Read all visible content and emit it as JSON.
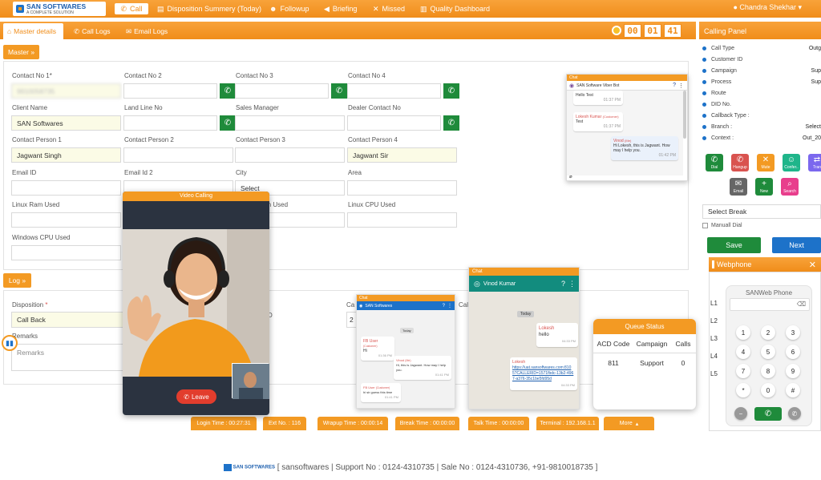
{
  "brand": {
    "name": "SAN SOFTWARES",
    "tagline": "A COMPLETE SOLUTION"
  },
  "nav": {
    "call": "Call",
    "disposition": "Disposition Summery (Today)",
    "followup": "Followup",
    "briefing": "Briefing",
    "missed": "Missed",
    "quality": "Quality Dashboard",
    "user": "Chandra Shekhar"
  },
  "tabs": {
    "master": "Master details",
    "call_logs": "Call Logs",
    "email_logs": "Email Logs"
  },
  "timer": [
    "00",
    "01",
    "41"
  ],
  "master": {
    "button": "Master",
    "fields": [
      {
        "label": "Contact No 1*",
        "value": "9910058735"
      },
      {
        "label": "Contact No 2",
        "value": ""
      },
      {
        "label": "Contact No 3",
        "value": ""
      },
      {
        "label": "Contact No 4",
        "value": ""
      },
      {
        "label": "Client Name",
        "value": "SAN Softwares"
      },
      {
        "label": "Land Line No",
        "value": ""
      },
      {
        "label": "Sales Manager",
        "value": ""
      },
      {
        "label": "Dealer Contact No",
        "value": ""
      },
      {
        "label": "Contact Person 1",
        "value": "Jagwant Singh"
      },
      {
        "label": "Contact Person 2",
        "value": ""
      },
      {
        "label": "Contact Person 3",
        "value": ""
      },
      {
        "label": "Contact Person 4",
        "value": "Jagwant Sir"
      },
      {
        "label": "Email ID",
        "value": ""
      },
      {
        "label": "Email Id 2",
        "value": ""
      },
      {
        "label": "City",
        "value": "Select"
      },
      {
        "label": "Area",
        "value": ""
      },
      {
        "label": "Linux Ram Used",
        "value": ""
      },
      {
        "label": "am Used",
        "value": ""
      },
      {
        "label": "Linux CPU Used",
        "value": ""
      },
      {
        "label": "Windows CPU Used",
        "value": ""
      }
    ]
  },
  "log": {
    "button": "Log",
    "disposition_label": "Disposition",
    "disposition_value": "Call Back",
    "remarks_label": "Remarks",
    "remarks_placeholder": "Remarks",
    "ca_label": "Ca",
    "cal_label": "Cal",
    "d_label": "D",
    "val2": "2"
  },
  "calling_panel": {
    "title": "Calling Panel",
    "rows": [
      {
        "label": "Call Type",
        "value": "Outg"
      },
      {
        "label": "Customer ID",
        "value": ""
      },
      {
        "label": "Campaign",
        "value": "Sup"
      },
      {
        "label": "Process",
        "value": "Sup"
      },
      {
        "label": "Route",
        "value": ""
      },
      {
        "label": "DID No.",
        "value": ""
      },
      {
        "label": "Callback Type :",
        "value": ""
      },
      {
        "label": "Branch :",
        "value": "Select"
      },
      {
        "label": "Context :",
        "value": "Out_20"
      }
    ],
    "buttons": [
      {
        "label": "Dial",
        "color": "#1f8b3b",
        "icon": "✆"
      },
      {
        "label": "Hangup",
        "color": "#d9534f",
        "icon": "✆"
      },
      {
        "label": "Mute",
        "color": "#f39a23",
        "icon": "✕"
      },
      {
        "label": "Confer..",
        "color": "#1fb58a",
        "icon": "☺"
      },
      {
        "label": "Tran",
        "color": "#7b68ee",
        "icon": "⇄"
      },
      {
        "label": "Email",
        "color": "#666666",
        "icon": "✉"
      },
      {
        "label": "New",
        "color": "#1f8b3b",
        "icon": "+"
      },
      {
        "label": "Search",
        "color": "#e83e8c",
        "icon": "⌕"
      }
    ],
    "select_break": "Select Break",
    "manual_dial": "Manuall Dial",
    "save": "Save",
    "next": "Next"
  },
  "webphone": {
    "title": "Webphone",
    "phone_title": "SANWeb Phone",
    "lines": [
      "L1",
      "L2",
      "L3",
      "L4",
      "L5"
    ],
    "keys": [
      "1",
      "2",
      "3",
      "4",
      "5",
      "6",
      "7",
      "8",
      "9",
      "*",
      "0",
      "#"
    ]
  },
  "video": {
    "title": "Video Calling",
    "leave": "Leave"
  },
  "viber": {
    "title": "Chat",
    "header": "SAN Software Viber Bot",
    "messages": [
      {
        "text": "Hello Test",
        "time": "01:37 PM"
      },
      {
        "name": "Lokesh Kumar",
        "tag": "(Customer)",
        "text": "Test",
        "time": "01:37 PM"
      },
      {
        "name": "Vinod",
        "tag": "(Me)",
        "text": "Hi Lokesh, this is Jagwant. How may I help you.",
        "time": "01:42 PM"
      }
    ]
  },
  "fbchat": {
    "title": "Chat",
    "header": "SAN Softwares",
    "today": "Today",
    "messages": [
      {
        "name": "FB User",
        "tag": "(Customer)",
        "text": "Hi",
        "time": "01:36 PM"
      },
      {
        "name": "Vinod",
        "tag": "(Me)",
        "text": "Hi, this is Jagwant. How may I help you.",
        "time": "01:41 PM"
      },
      {
        "name": "FB User",
        "tag": "(Customer)",
        "text": "hi sir guess this time",
        "time": "01:41 PM"
      }
    ]
  },
  "wachat": {
    "title": "Chat",
    "header": "Vinod Kumar",
    "today": "Today",
    "msg1": {
      "name": "Lokesh",
      "text": "hello",
      "time": "04:33 PM"
    },
    "msg2": {
      "name": "Lokesh",
      "text": "https://uat.sansoftwares.com:8105?CALLERID=1571fbdc-13b2-4967-a376-35c1be5fd95d",
      "time": "04:33 PM"
    }
  },
  "queue": {
    "title": "Queue Status",
    "headers": [
      "ACD Code",
      "Campaign",
      "Calls"
    ],
    "rows": [
      [
        "811",
        "Support",
        "0"
      ]
    ]
  },
  "statusbar": [
    "Login Time : 00:27:31",
    "Ext No. : 116",
    "Wrapup Time : 00:00:14",
    "Break Time : 00:00:00",
    "Talk Time : 00:00:00",
    "Terminal : 192.168.1.1",
    "More"
  ],
  "footer": "[ sansoftwares | Support No : 0124-4310735 | Sale No : 0124-4310736, +91-9810018735 ]"
}
